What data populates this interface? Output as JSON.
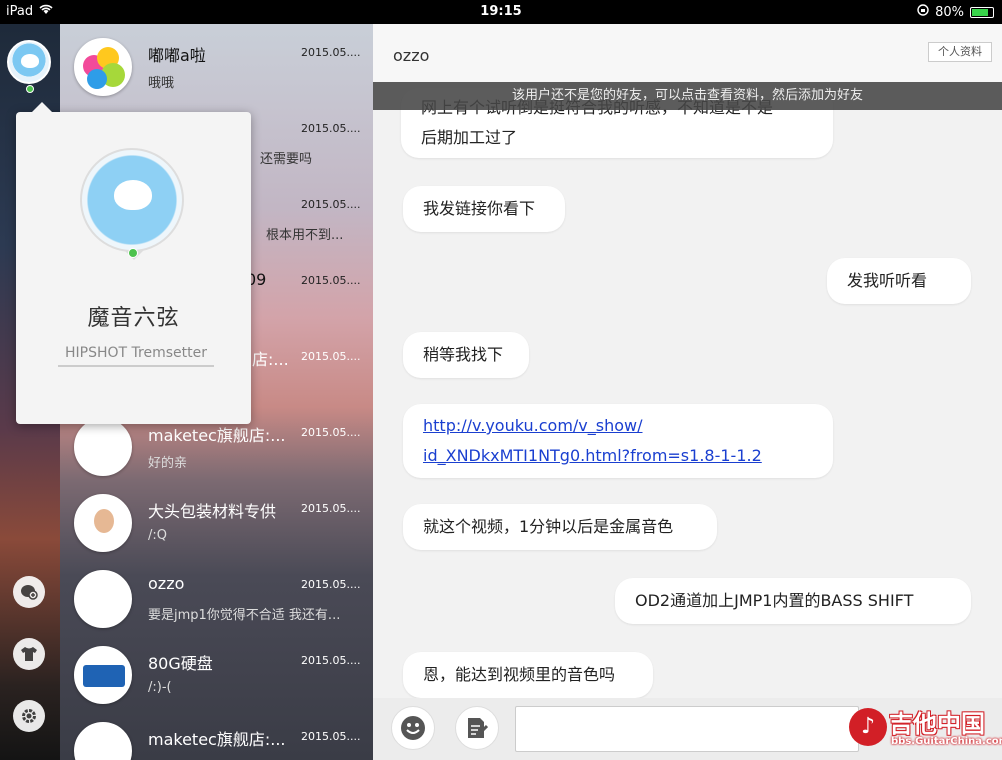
{
  "status_bar": {
    "device": "iPad",
    "time": "19:15",
    "battery": "80%",
    "battery_level": 0.8
  },
  "popover": {
    "name": "魔音六弦",
    "signature": "HIPSHOT Tremsetter"
  },
  "conversations": [
    {
      "name": "嘟嘟a啦",
      "time": "2015.05....",
      "message": "哦哦",
      "avatar": "colorful-balls"
    },
    {
      "name": "",
      "time": "2015.05....",
      "message": "还需要吗",
      "avatar": "hidden"
    },
    {
      "name": "",
      "time": "2015.05....",
      "message": "根本用不到...",
      "avatar": "hidden"
    },
    {
      "name": "09",
      "time": "2015.05....",
      "message": "",
      "avatar": "hidden"
    },
    {
      "name": "店:...",
      "time": "2015.05....",
      "message": "",
      "avatar": "hidden"
    },
    {
      "name": "maketec旗舰店:...",
      "time": "2015.05....",
      "message": "好的亲",
      "avatar": "bubble"
    },
    {
      "name": "大头包装材料专供",
      "time": "2015.05....",
      "message": "/:Q",
      "avatar": "kid-photo"
    },
    {
      "name": "ozzo",
      "time": "2015.05....",
      "message": "要是jmp1你觉得不合适 我还有...",
      "avatar": "bubble"
    },
    {
      "name": "80G硬盘",
      "time": "2015.05....",
      "message": "/:)-(",
      "avatar": "disk-photo"
    },
    {
      "name": "maketec旗舰店:...",
      "time": "2015.05....",
      "message": "",
      "avatar": "bubble"
    }
  ],
  "chat": {
    "title": "ozzo",
    "profile_button": "个人资料",
    "notice": "该用户还不是您的好友，可以点击查看资料，然后添加为好友",
    "messages": [
      {
        "side": "left",
        "lines": [
          "网上有个试听倒是挺符合我的听感，不知道是不是",
          "后期加工过了"
        ]
      },
      {
        "side": "left",
        "lines": [
          "我发链接你看下"
        ]
      },
      {
        "side": "right",
        "lines": [
          "发我听听看"
        ]
      },
      {
        "side": "left",
        "lines": [
          "稍等我找下"
        ]
      },
      {
        "side": "left",
        "link": true,
        "lines": [
          "http://v.youku.com/v_show/",
          "id_XNDkxMTI1NTg0.html?from=s1.8-1-1.2"
        ]
      },
      {
        "side": "left",
        "lines": [
          "就这个视频，1分钟以后是金属音色"
        ]
      },
      {
        "side": "right",
        "lines": [
          "OD2通道加上JMP1内置的BASS SHIFT"
        ]
      },
      {
        "side": "left",
        "lines": [
          "恩，能达到视频里的音色吗"
        ]
      }
    ]
  },
  "watermark": {
    "text": "吉他中国",
    "url": "bbs.GuitarChina.com"
  },
  "icons": {
    "status": [
      "wifi-icon",
      "rotation-lock-icon",
      "battery-icon"
    ],
    "strip": [
      "add-chat-icon",
      "shirt-icon",
      "gear-icon"
    ],
    "composer": [
      "smiley-icon",
      "note-icon"
    ]
  },
  "colors": {
    "link": "#1a3fd0",
    "online": "#4dc24d",
    "watermark": "#d21f26"
  }
}
